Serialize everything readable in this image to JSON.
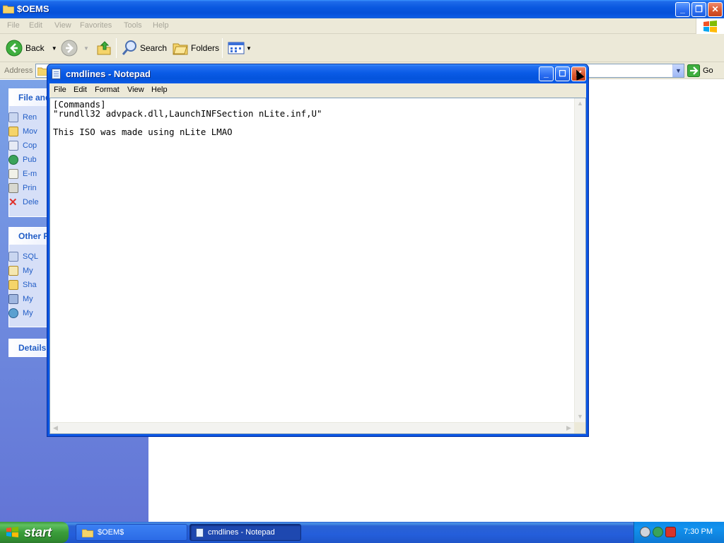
{
  "explorer": {
    "title": "$OEMS",
    "menu": [
      "File",
      "Edit",
      "View",
      "Favorites",
      "Tools",
      "Help"
    ],
    "toolbar": {
      "back": "Back",
      "search": "Search",
      "folders": "Folders"
    },
    "address": {
      "label": "Address",
      "go": "Go"
    },
    "taskpane": {
      "file_tasks_head": "File and",
      "file_tasks": [
        "Ren",
        "Mov",
        "Cop",
        "Pub",
        "E-m",
        "Prin",
        "Dele"
      ],
      "other_head": "Other P",
      "other_items": [
        "SQL",
        "My",
        "Sha",
        "My",
        "My"
      ],
      "details_head": "Details"
    }
  },
  "notepad": {
    "title": "cmdlines - Notepad",
    "menu": [
      "File",
      "Edit",
      "Format",
      "View",
      "Help"
    ],
    "content": "[Commands]\n\"rundll32 advpack.dll,LaunchINFSection nLite.inf,U\"\n\nThis ISO was made using nLite LMAO"
  },
  "taskbar": {
    "start": "start",
    "tasks": [
      "$OEM$",
      "cmdlines - Notepad"
    ],
    "clock": "7:30 PM"
  },
  "colors": {
    "xp_blue": "#0a58e0",
    "start_green": "#3a9d3a",
    "tray_blue": "#0e8ae8",
    "taskpane_link": "#215dc6"
  }
}
